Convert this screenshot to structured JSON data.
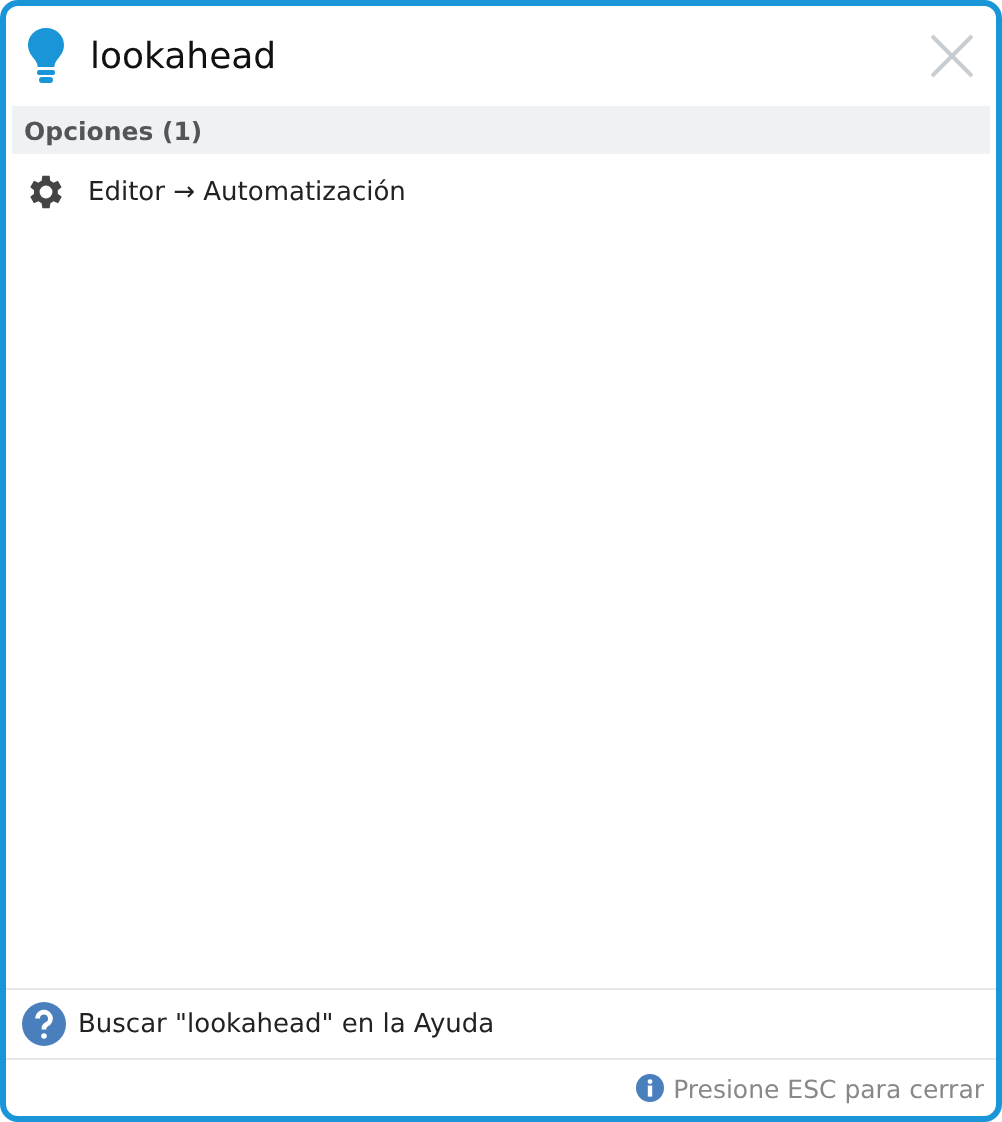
{
  "search": {
    "value": "lookahead"
  },
  "sections": [
    {
      "title": "Opciones (1)",
      "items": [
        {
          "kind": "settings",
          "label": "Editor → Automatización"
        }
      ]
    }
  ],
  "help_link": "Buscar \"lookahead\" en la Ayuda",
  "status_bar": "Presione ESC para cerrar"
}
